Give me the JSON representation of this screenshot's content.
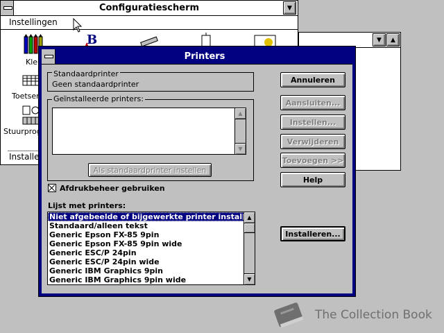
{
  "control_panel": {
    "title": "Configuratiescherm",
    "menu": [
      "Instellingen"
    ],
    "icons": [
      {
        "label": "Kleu",
        "icon": "color-pencils-icon"
      },
      {
        "label": "Toetsen",
        "icon": "keyboard-icon"
      },
      {
        "label": "Stuurprogra",
        "icon": "drivers-icon"
      }
    ],
    "status": "Installe"
  },
  "printers_dialog": {
    "title": "Printers",
    "default_printer": {
      "label": "Standaardprinter",
      "value": "Geen standaardprinter"
    },
    "installed": {
      "label": "Geïnstalleerde printers:",
      "items": []
    },
    "set_default_label": "Als standaardprinter instellen",
    "print_manager": {
      "label": "Afdrukbeheer gebruiken",
      "checked": true
    },
    "list_label": "Lijst met printers:",
    "printer_list": [
      "Niet afgebeelde of bijgewerkte printer installeren",
      "Standaard/alleen tekst",
      "Generic Epson FX-85 9pin",
      "Generic Epson FX-85 9pin wide",
      "Generic ESC/P 24pin",
      "Generic ESC/P 24pin wide",
      "Generic IBM Graphics 9pin",
      "Generic IBM Graphics 9pin wide"
    ],
    "buttons": {
      "cancel": "Annuleren",
      "connect": "Aansluiten...",
      "setup": "Instellen...",
      "remove": "Verwijderen",
      "add": "Toevoegen >>",
      "help": "Help",
      "install": "Installeren..."
    }
  },
  "watermark": "The Collection Book",
  "colors": {
    "title_active": "#000080",
    "face": "#c0c0c0",
    "desktop": "#c0c0c0"
  }
}
